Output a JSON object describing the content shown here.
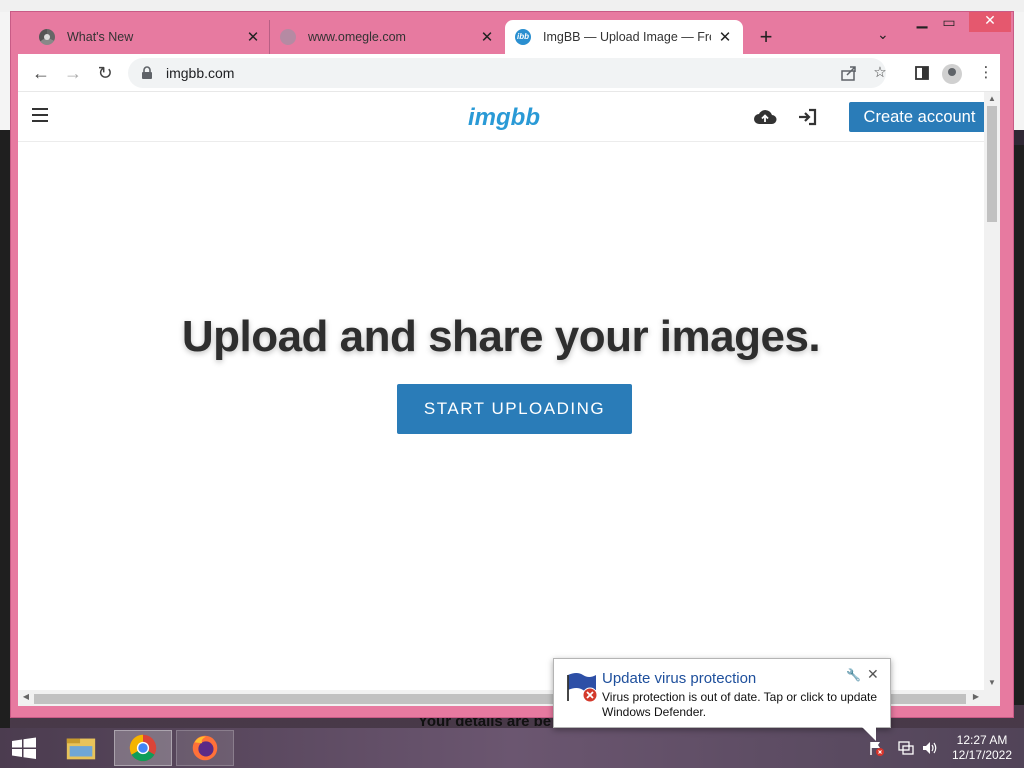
{
  "browser": {
    "tabs": [
      {
        "title": "What's New",
        "active": false
      },
      {
        "title": "www.omegle.com",
        "active": false
      },
      {
        "title": "ImgBB — Upload Image — Free",
        "active": true
      }
    ],
    "favicon_text": "ibb",
    "url": "imgbb.com"
  },
  "site": {
    "logo": "imgbb",
    "create_account": "Create account",
    "hero": "Upload and share your images.",
    "start_button": "START UPLOADING",
    "brand_color": "#2a7cb8",
    "logo_color": "#2a9ad6"
  },
  "behind": {
    "text": "Your details are be"
  },
  "notification": {
    "title": "Update virus protection",
    "body": "Virus protection is out of date. Tap or click to update Windows Defender."
  },
  "taskbar": {
    "time": "12:27 AM",
    "date": "12/17/2022"
  },
  "icons": {
    "window_frame_color": "#e77aa0",
    "taskbar_color": "#5a4a5e"
  }
}
